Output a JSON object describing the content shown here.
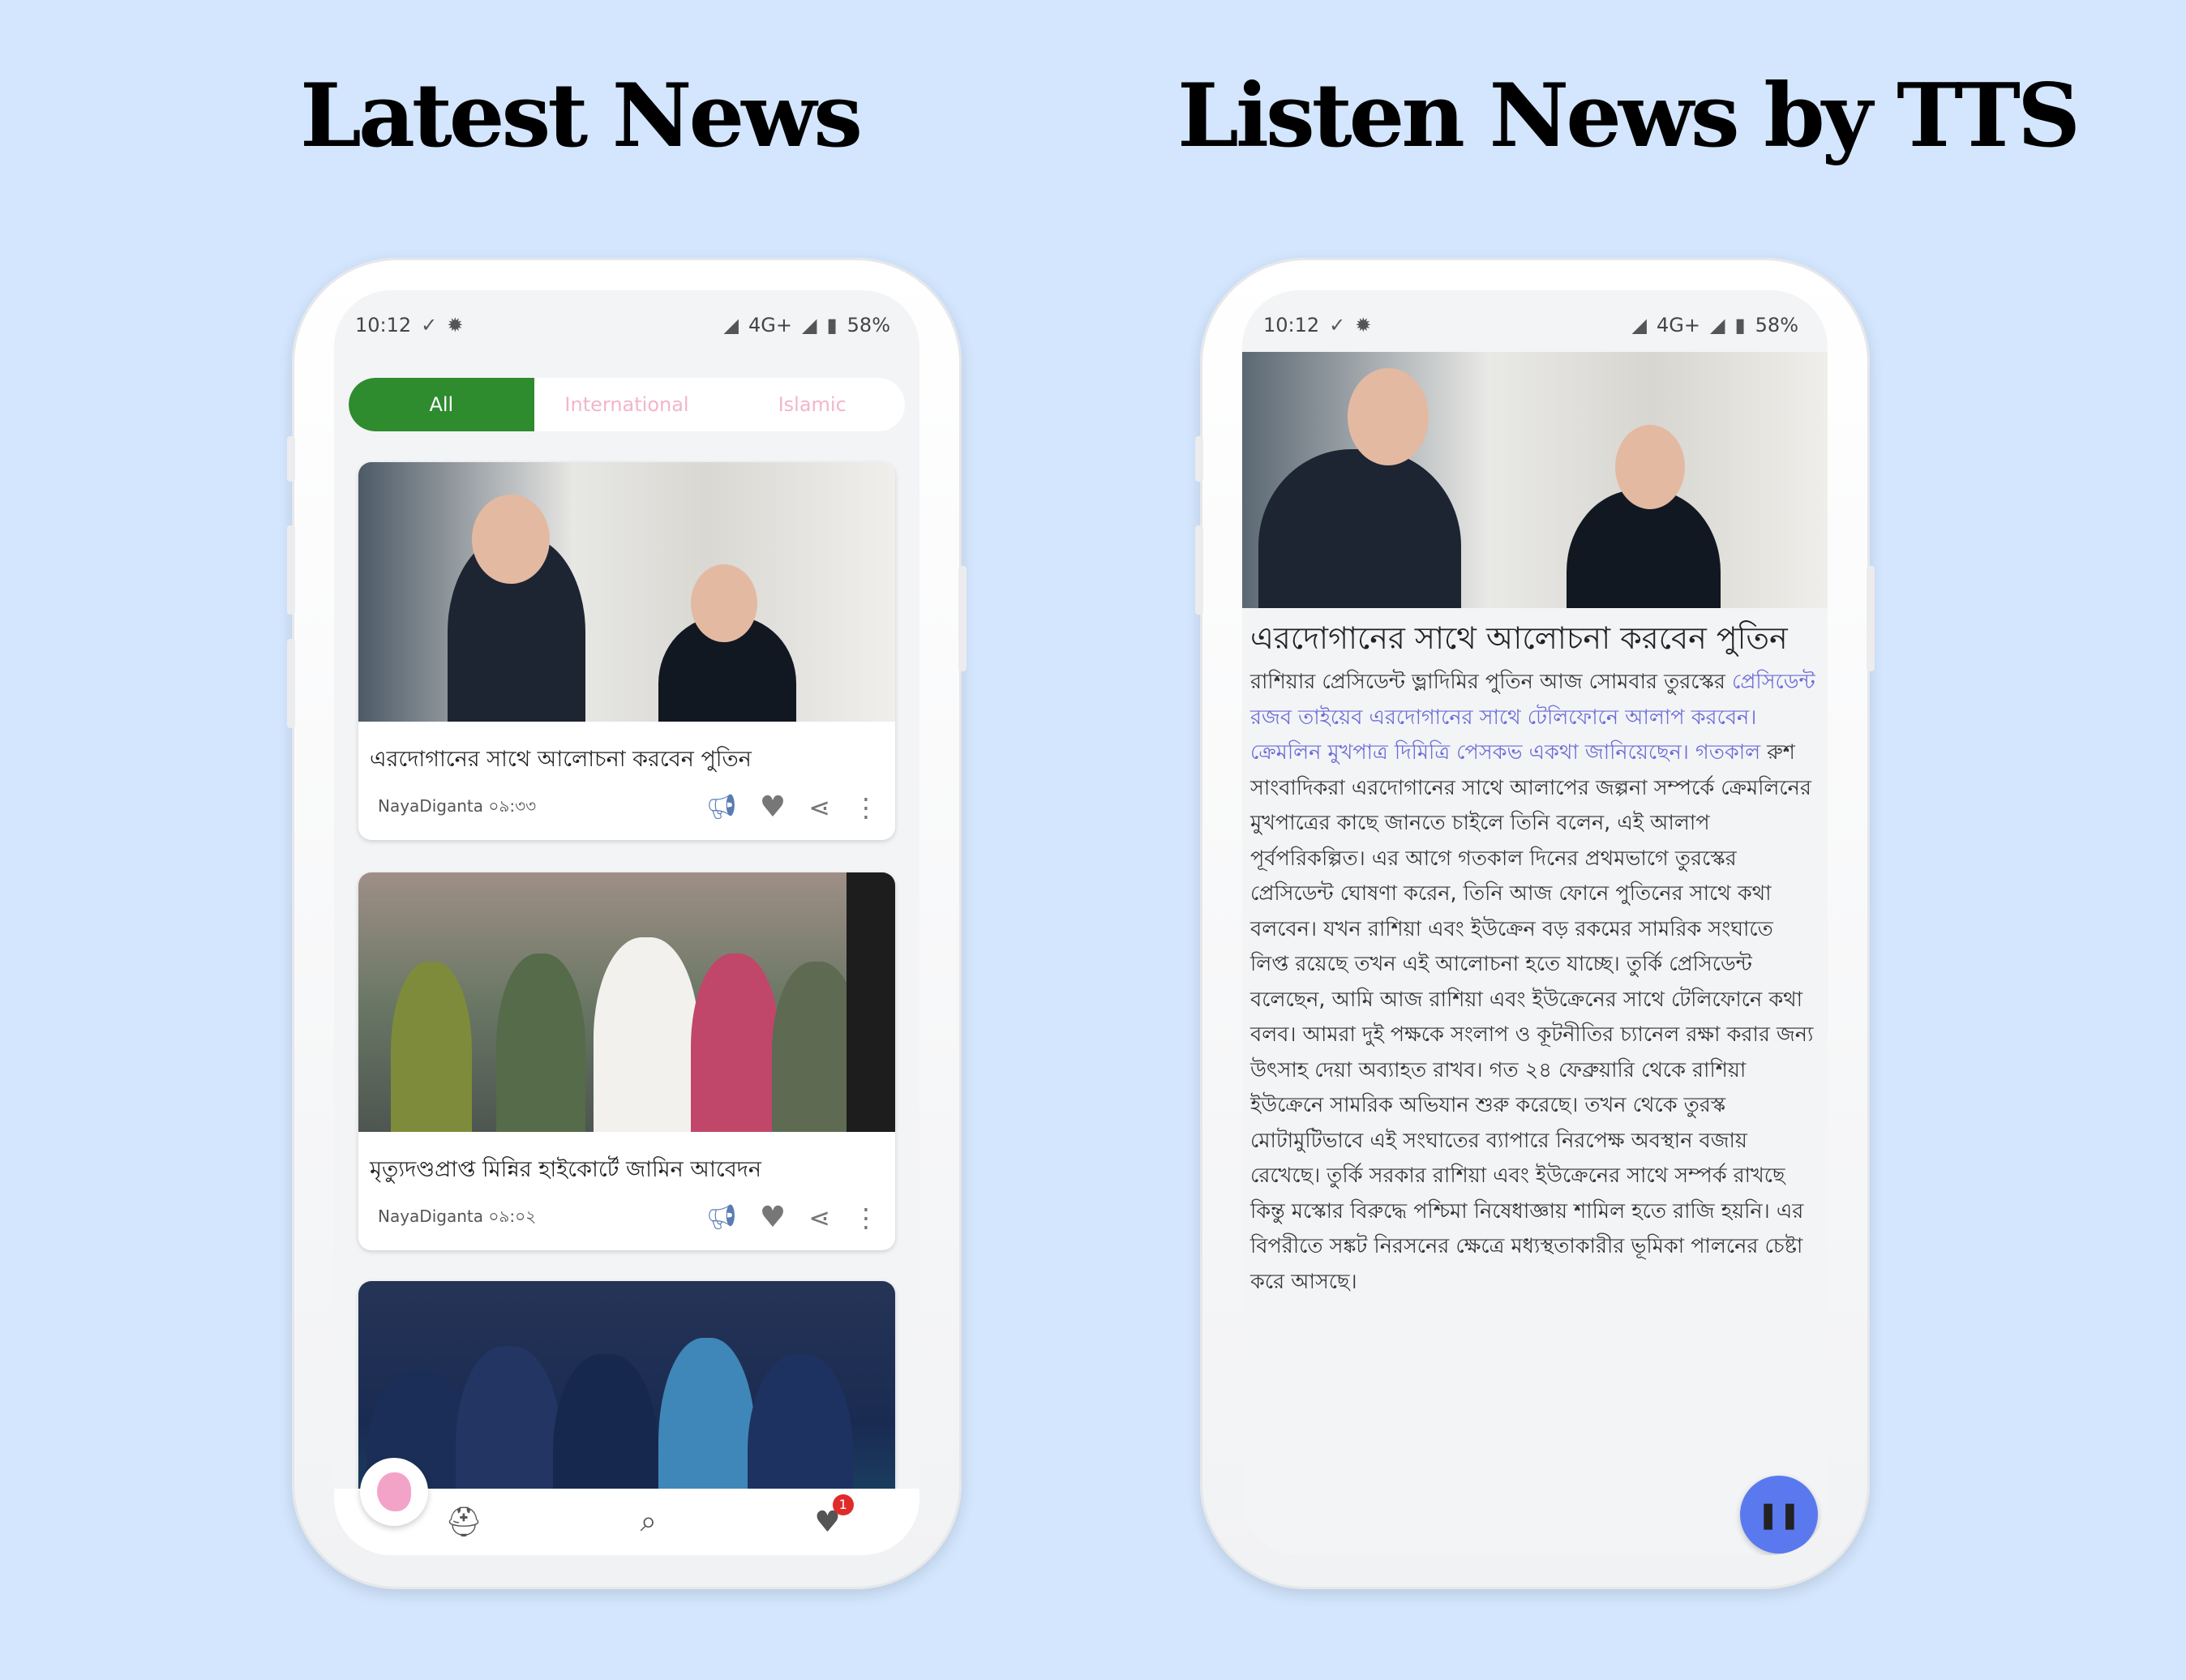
{
  "headings": {
    "left": "Latest News",
    "right": "Listen News by TTS"
  },
  "status_bar": {
    "time": "10:12",
    "network": "4G+",
    "battery": "58%"
  },
  "tabs": [
    {
      "label": "All",
      "active": true
    },
    {
      "label": "International",
      "active": false
    },
    {
      "label": "Islamic",
      "active": false
    }
  ],
  "news": [
    {
      "title": "এরদোগানের সাথে আলোচনা করবেন পুতিন",
      "source": "NayaDiganta",
      "time": "০৯:৩৩"
    },
    {
      "title": "মৃত্যুদণ্ডপ্রাপ্ত মিন্নির হাইকোর্টে জামিন আবেদন",
      "source": "NayaDiganta",
      "time": "০৯:০২"
    }
  ],
  "favorites_badge": "1",
  "detail": {
    "title": "এরদোগানের সাথে আলোচনা করবেন পুতিন",
    "body_intro": "রাশিয়ার প্রেসিডেন্ট ভ্লাদিমির পুতিন আজ সোমবার তুরস্কের ",
    "body_highlight": "প্রেসিডেন্ট রজব তাইয়েব এরদোগানের সাথে টেলিফোনে আলাপ করবেন। ক্রেমলিন মুখপাত্র দিমিত্রি পেসকভ একথা জানিয়েছেন। গতকাল",
    "body_rest": " রুশ সাংবাদিকরা এরদোগানের সাথে আলাপের জল্পনা সম্পর্কে ক্রেমলিনের মুখপাত্রের কাছে জানতে চাইলে তিনি বলেন, এই আলাপ পূর্বপরিকল্পিত। এর আগে গতকাল দিনের প্রথমভাগে তুরস্কের প্রেসিডেন্ট ঘোষণা করেন, তিনি আজ ফোনে পুতিনের সাথে কথা বলবেন। যখন রাশিয়া এবং ইউক্রেন বড় রকমের সামরিক সংঘাতে লিপ্ত রয়েছে তখন এই আলোচনা হতে যাচ্ছে। তুর্কি প্রেসিডেন্ট বলেছেন, আমি আজ রাশিয়া এবং ইউক্রেনের সাথে টেলিফোনে কথা বলব। আমরা দুই পক্ষকে সংলাপ ও কূটনীতির চ্যানেল রক্ষা করার জন্য উৎসাহ দেয়া অব্যাহত রাখব। গত ২৪ ফেব্রুয়ারি থেকে রাশিয়া ইউক্রেনে সামরিক অভিযান শুরু করেছে। তখন থেকে তুরস্ক মোটামুটিভাবে এই সংঘাতের ব্যাপারে নিরপেক্ষ অবস্থান বজায় রেখেছে। তুর্কি সরকার রাশিয়া এবং ইউক্রেনের সাথে সম্পর্ক রাখছে কিন্তু মস্কোর বিরুদ্ধে পশ্চিমা নিষেধাজ্ঞায় শামিল হতে রাজি হয়নি। এর বিপরীতে সঙ্কট নিরসনের ক্ষেত্রে মধ্যস্থতাকারীর ভূমিকা পালনের চেষ্টা করে আসছে।"
  },
  "icons": {
    "speaker": "megaphone-icon",
    "favorite": "heart-icon",
    "share": "share-icon",
    "more": "more-vert-icon",
    "pause": "pause-icon"
  },
  "colors": {
    "background": "#d3e6fd",
    "tab_active": "#2e8b2e",
    "tab_inactive_text": "#f2b5cc",
    "link": "#6b6bd8",
    "fab": "#5b79ee",
    "badge": "#e02b2b"
  }
}
